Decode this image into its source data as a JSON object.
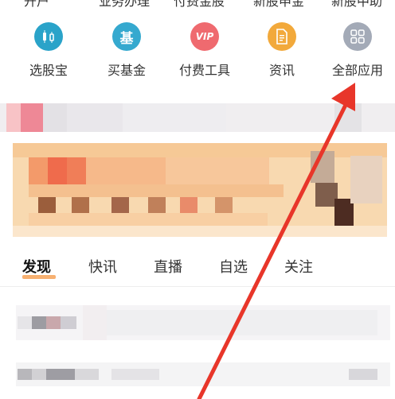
{
  "top_row": {
    "items": [
      "开户",
      "业务办理",
      "付费金股",
      "新股申金",
      "新股中助"
    ]
  },
  "shortcuts": [
    {
      "label": "选股宝",
      "icon": "candlestick-icon",
      "color": "#2aa3c9",
      "glyph": ""
    },
    {
      "label": "买基金",
      "icon": "fund-icon",
      "color": "#35a9cf",
      "glyph": "基"
    },
    {
      "label": "付费工具",
      "icon": "vip-icon",
      "color": "#ef6a6f",
      "glyph": "VIP"
    },
    {
      "label": "资讯",
      "icon": "document-icon",
      "color": "#f2a93b",
      "glyph": ""
    },
    {
      "label": "全部应用",
      "icon": "grid-icon",
      "color": "#a3aab7",
      "glyph": ""
    }
  ],
  "tabs": [
    {
      "label": "发现",
      "active": true
    },
    {
      "label": "快讯",
      "active": false
    },
    {
      "label": "直播",
      "active": false
    },
    {
      "label": "自选",
      "active": false
    },
    {
      "label": "关注",
      "active": false
    }
  ],
  "colors": {
    "accent": "#f7b071",
    "arrow": "#e8362a"
  }
}
